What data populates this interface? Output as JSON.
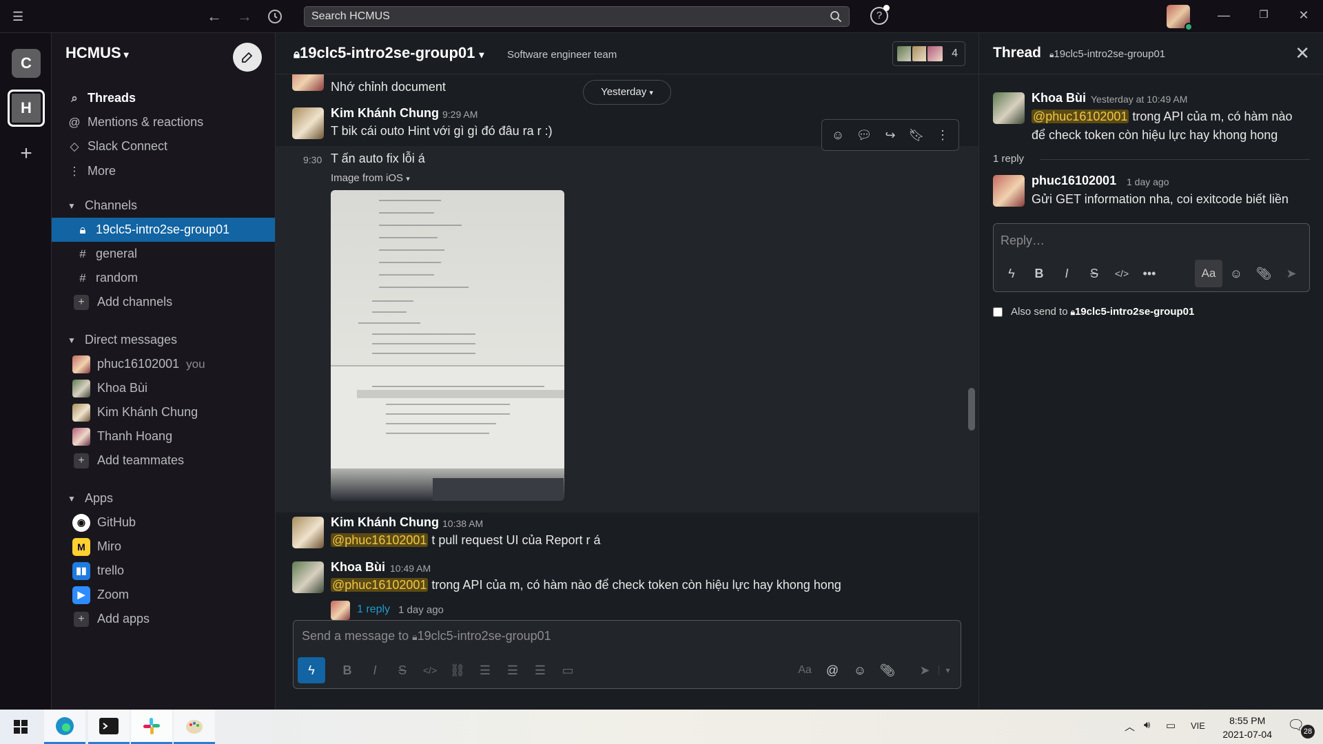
{
  "topbar": {
    "search_placeholder": "Search HCMUS"
  },
  "workspaces": [
    "C",
    "H"
  ],
  "sidebar": {
    "workspace_name": "HCMUS",
    "nav": [
      {
        "label": "Threads",
        "icon": "threads-icon"
      },
      {
        "label": "Mentions & reactions",
        "icon": "at-icon"
      },
      {
        "label": "Slack Connect",
        "icon": "slack-connect-icon"
      },
      {
        "label": "More",
        "icon": "more-vertical-icon"
      }
    ],
    "channels_label": "Channels",
    "channels": [
      "19clc5-intro2se-group01",
      "general",
      "random"
    ],
    "add_channels": "Add channels",
    "dm_label": "Direct messages",
    "dms": [
      "phuc16102001",
      "Khoa Bùi",
      "Kim Khánh Chung",
      "Thanh Hoang"
    ],
    "you_label": "you",
    "add_teammates": "Add teammates",
    "apps_label": "Apps",
    "apps": [
      "GitHub",
      "Miro",
      "trello",
      "Zoom"
    ],
    "add_apps": "Add apps"
  },
  "channel": {
    "name": "19clc5-intro2se-group01",
    "topic": "Software engineer team",
    "member_count": "4",
    "date_divider": "Yesterday"
  },
  "messages": [
    {
      "text": "Nhớ chỉnh document"
    },
    {
      "author": "Kim Khánh Chung",
      "time": "9:29 AM",
      "text": "T bik cái outo Hint với gì gì đó đâu ra r :)"
    },
    {
      "time": "9:30",
      "text": "T ấn auto fix lỗi á",
      "attachment": "Image from iOS"
    },
    {
      "author": "Kim Khánh Chung",
      "time": "10:38 AM",
      "mention": "@phuc16102001",
      "text": " t pull request UI của Report r á"
    },
    {
      "author": "Khoa Bùi",
      "time": "10:49 AM",
      "mention": "@phuc16102001",
      "text": " trong API của m, có hàm nào để check token còn hiệu lực hay khong hong",
      "replies": "1 reply",
      "reply_when": "1 day ago"
    }
  ],
  "composer": {
    "placeholder": "Send a message to ",
    "channel": "19clc5-intro2se-group01"
  },
  "thread": {
    "title": "Thread",
    "channel": "19clc5-intro2se-group01",
    "parent": {
      "author": "Khoa Bùi",
      "time": "Yesterday at 10:49 AM",
      "mention": "@phuc16102001",
      "text": " trong API của m, có hàm nào để check token còn hiệu lực hay khong hong"
    },
    "reply_count": "1 reply",
    "reply": {
      "author": "phuc16102001",
      "time": "1 day ago",
      "text": "Gửi GET information nha, coi exitcode biết liền"
    },
    "reply_placeholder": "Reply…",
    "also_send": "Also send to",
    "also_send_channel": "19clc5-intro2se-group01"
  },
  "taskbar": {
    "language": "VIE",
    "time": "8:55 PM",
    "date": "2021-07-04",
    "notifications": "28"
  }
}
